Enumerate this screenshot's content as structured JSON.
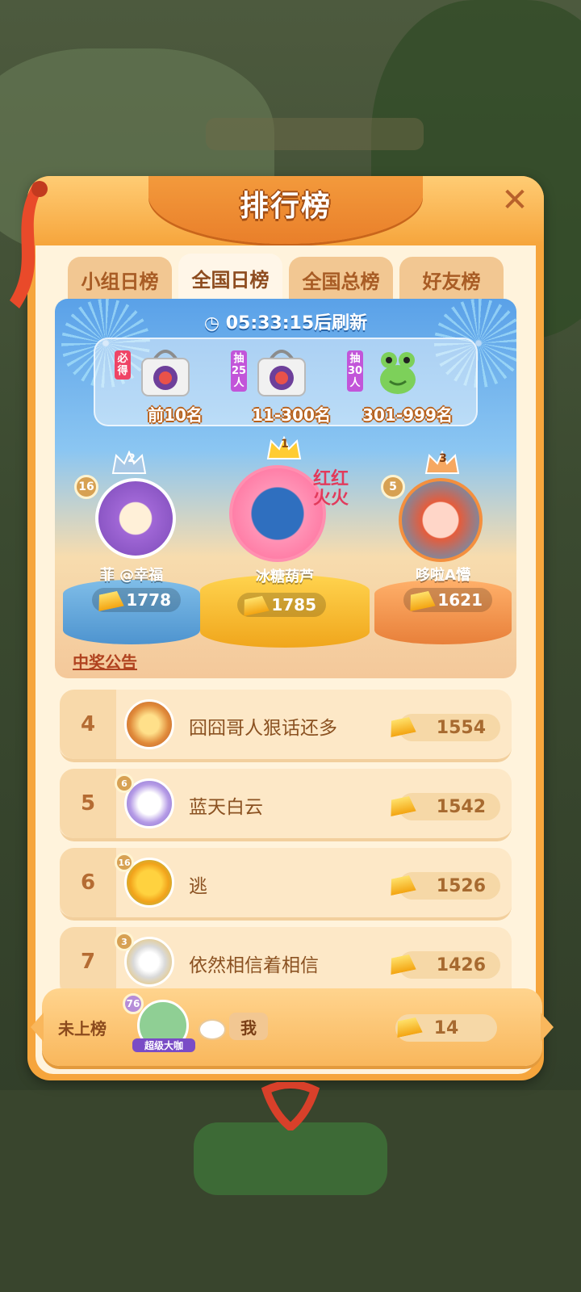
{
  "panel": {
    "title": "排行榜",
    "close_label": "✕",
    "tabs": [
      {
        "label": "小组日榜",
        "active": false
      },
      {
        "label": "全国日榜",
        "active": true
      },
      {
        "label": "全国总榜",
        "active": false
      },
      {
        "label": "好友榜",
        "active": false
      }
    ]
  },
  "board": {
    "refresh_text": "05:33:15后刷新",
    "prizes": [
      {
        "tag": "必得",
        "range": "前10名",
        "tag_color": "#ef4466"
      },
      {
        "tag": "抽25人",
        "range": "11-300名",
        "tag_color": "#c255d9"
      },
      {
        "tag": "抽30人",
        "range": "301-999名",
        "tag_color": "#c255d9"
      }
    ],
    "podium": [
      {
        "rank": "2",
        "level": "16",
        "name": "菲 @幸福",
        "score": "1778"
      },
      {
        "rank": "1",
        "name": "冰糖葫芦",
        "score": "1785",
        "frame_text": "红红火火"
      },
      {
        "rank": "3",
        "level": "5",
        "name": "哆啦A懵",
        "score": "1621"
      }
    ]
  },
  "announcement": "中奖公告",
  "list": [
    {
      "rank": "4",
      "name": "囧囧哥人狠话还多",
      "score": "1554",
      "level": ""
    },
    {
      "rank": "5",
      "name": "蓝天白云",
      "score": "1542",
      "level": "6"
    },
    {
      "rank": "6",
      "name": "逃",
      "score": "1526",
      "level": "16"
    },
    {
      "rank": "7",
      "name": "依然相信着相信",
      "score": "1426",
      "level": "3"
    }
  ],
  "me": {
    "status": "未上榜",
    "level": "76",
    "frame_label": "超级大咖",
    "name": "我",
    "score": "14"
  },
  "colors": {
    "panel_orange": "#f6a53c",
    "gold": "#f3a411",
    "rank_text": "#b56c33"
  }
}
